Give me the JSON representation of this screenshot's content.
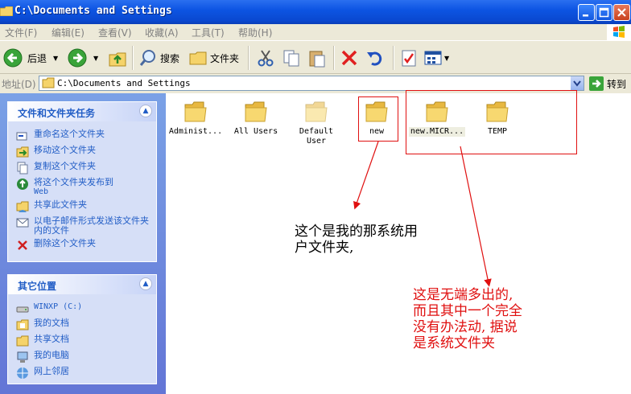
{
  "window": {
    "title": "C:\\Documents and Settings"
  },
  "menu": [
    "文件(F)",
    "编辑(E)",
    "查看(V)",
    "收藏(A)",
    "工具(T)",
    "帮助(H)"
  ],
  "toolbar": {
    "back": "后退",
    "search": "搜索",
    "folders": "文件夹"
  },
  "address": {
    "label": "地址(D)",
    "value": "C:\\Documents and Settings",
    "go": "转到"
  },
  "tasks_panel": {
    "title": "文件和文件夹任务",
    "items": [
      {
        "label": "重命名这个文件夹",
        "icon": "rename-icon"
      },
      {
        "label": "移动这个文件夹",
        "icon": "move-icon"
      },
      {
        "label": "复制这个文件夹",
        "icon": "copy-icon"
      },
      {
        "label": "将这个文件夹发布到",
        "label2": "Web",
        "icon": "publish-web-icon"
      },
      {
        "label": "共享此文件夹",
        "icon": "share-icon"
      },
      {
        "label": "以电子邮件形式发送该文件夹内的文件",
        "icon": "email-icon"
      },
      {
        "label": "删除这个文件夹",
        "icon": "delete-icon"
      }
    ]
  },
  "places_panel": {
    "title": "其它位置",
    "items": [
      {
        "label": "WINXP (C:)",
        "icon": "drive-icon"
      },
      {
        "label": "我的文档",
        "icon": "folder-icon"
      },
      {
        "label": "共享文档",
        "icon": "folder-icon"
      },
      {
        "label": "我的电脑",
        "icon": "computer-icon"
      },
      {
        "label": "网上邻居",
        "icon": "network-icon"
      }
    ]
  },
  "folders": [
    {
      "label": "Administ...",
      "label2": ""
    },
    {
      "label": "All Users",
      "label2": ""
    },
    {
      "label": "Default",
      "label2": "User"
    },
    {
      "label": "new",
      "label2": ""
    },
    {
      "label": "new.MICR...",
      "label2": ""
    },
    {
      "label": "TEMP",
      "label2": ""
    }
  ],
  "annotations": {
    "note1_line1": "这个是我的那系统用",
    "note1_line2": "户文件夹,",
    "note2_line1": "这是无端多出的,",
    "note2_line2": "而且其中一个完全",
    "note2_line3": "没有办法动, 据说",
    "note2_line4": "是系统文件夹",
    "note2_color": "#e01010"
  }
}
